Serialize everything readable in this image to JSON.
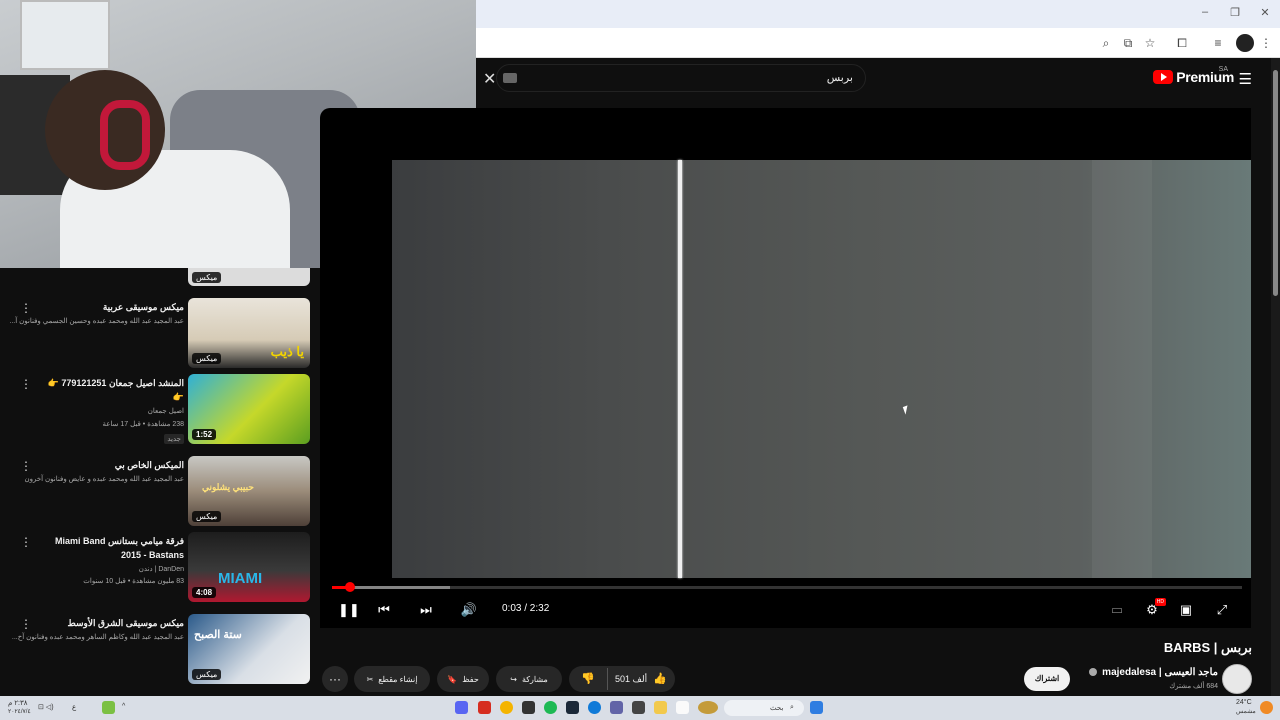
{
  "browser": {
    "minimize": "–",
    "maximize": "❐",
    "close": "✕",
    "toolbar_icons": [
      "zoom-icon",
      "install-icon",
      "bookmark-star-icon",
      "extensions-icon",
      "media-icon",
      "profile-icon",
      "more-icon"
    ]
  },
  "header": {
    "search_value": "بربس",
    "logo_text": "Premium",
    "logo_region": "SA"
  },
  "sidebar": {
    "peek_badge": "ميكس",
    "items": [
      {
        "title": "ميكس موسيقى عربية",
        "sub1": "عبد المجيد عبد الله ومحمد عبده وحسين الجسمي وفنانون آ...",
        "sub2": "",
        "badge": "ميكس",
        "thumb_text": "يا ذيب"
      },
      {
        "title": "المنشد اصيل جمعان 779121251 👉👉",
        "sub1": "اصيل جمعان",
        "sub2": "238 مشاهدة • قبل 17 ساعة",
        "tag": "جديد",
        "duration": "1:52"
      },
      {
        "title": "الميكس الخاص بي",
        "sub1": "عبد المجيد عبد الله ومحمد عبده و عايض وفنانون آخرون",
        "sub2": "",
        "badge": "ميكس",
        "thumb_text": "حبيبي يشلوني"
      },
      {
        "title": "فرقة ميامي بستانس Miami Band 2015 - Bastans",
        "sub1": "DanDen | دندن",
        "sub2": "83 مليون مشاهدة • قبل 10 سنوات",
        "duration": "4:08",
        "thumb_text": "MIAMI"
      },
      {
        "title": "ميكس موسيقى الشرق الأوسط",
        "sub1": "عبد المجيد عبد الله وكاظم الساهر ومحمد عبده وفنانون آخ...",
        "sub2": "",
        "badge": "ميكس",
        "thumb_text": "ستة الصبح"
      }
    ]
  },
  "player": {
    "current_time": "0:03 / 2:32",
    "progress_fraction": 0.02,
    "buffer_fraction": 0.13,
    "hd_label": "HD"
  },
  "video": {
    "title": "بربس | BARBS",
    "channel_name": "ماجد العيسى | majedalesa",
    "channel_subs": "684 ألف مشترك",
    "subscribe_label": "اشتراك",
    "like_count": "501 ألف",
    "share_label": "مشاركة",
    "save_label": "حفظ",
    "clip_label": "إنشاء مقطع"
  },
  "taskbar": {
    "left_text": "٢:٣٨ م",
    "left_date": "٢٠٢٤/٧/٤",
    "lang": "ع",
    "search_label": "بحث",
    "weather": "24°C",
    "weather_desc": "مشمس"
  },
  "colors": {
    "accent_red": "#ff0000",
    "background": "#0f0f0f"
  }
}
